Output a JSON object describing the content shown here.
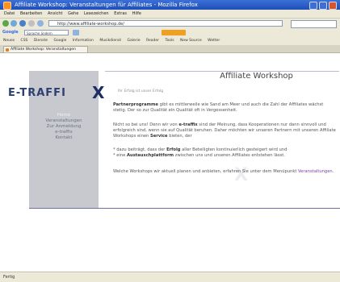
{
  "window": {
    "title": "Affiliate Workshop: Veranstaltungen für Affiliates - Mozilla Firefox"
  },
  "menu": {
    "items": [
      "Datei",
      "Bearbeiten",
      "Ansicht",
      "Gehe",
      "Lesezeichen",
      "Extras",
      "Hilfe"
    ]
  },
  "nav": {
    "url": "http://www.affiliate-workshop.de/"
  },
  "google_toolbar": {
    "label": "Google",
    "search_placeholder": "Sprache ändern"
  },
  "bookmarks": {
    "items": [
      "Neues",
      "CSS",
      "Dienste",
      "Google",
      "Information",
      "Musikdienst",
      "Galerie",
      "Reader",
      "Tools",
      "New Source",
      "Wetter"
    ]
  },
  "tab": {
    "label": "Affiliate Workshop: Veranstaltungen"
  },
  "page": {
    "logo_text": "E-TRAFFI",
    "logo_x": "X",
    "heading": "Affiliate Workshop",
    "slogan": "Ihr Erfolg ist unser Erfolg",
    "sidebar": {
      "items": [
        {
          "label": "Home",
          "active": true
        },
        {
          "label": "Veranstaltungen",
          "active": false
        },
        {
          "label": "Zur Anmeldung",
          "active": false
        },
        {
          "label": "e-traffix",
          "active": false
        },
        {
          "label": "Kontakt",
          "active": false
        }
      ]
    },
    "p1_strong": "Partnerprogramme",
    "p1_rest": " gibt es mittlerweile wie Sand am Meer und auch die Zahl der Affiliates wächst stetig. Der so zur Qualität ein Qualität oft in Vergessenheit.",
    "p2_a": "Nicht so bei uns! Denn wir von ",
    "p2_brand": "e-traffix",
    "p2_b": " sind der Meinung, dass Kooperationen nur dann sinnvoll und erfolgreich sind, wenn sie auf Qualität beruhen. Daher möchten wir unseren Partnern mit unseren Affiliate Workshops einen ",
    "p2_service": "Service",
    "p2_c": " bieten, der",
    "p3_a": "* dazu beiträgt, dass der ",
    "p3_erfolg": "Erfolg",
    "p3_b": " aller Beteiligten kontinuierlich gesteigert wird und",
    "p3_c": "* eine ",
    "p3_aus": "Austauschplattform",
    "p3_d": " zwischen uns und unseren Affiliates entstehen lässt.",
    "p4_a": "Welche Workshops wir aktuell planen und anbieten, erfahren Sie unter dem Menüpunkt ",
    "p4_link": "Veranstaltungen",
    "p4_b": "."
  },
  "status": {
    "text": "Fertig"
  }
}
